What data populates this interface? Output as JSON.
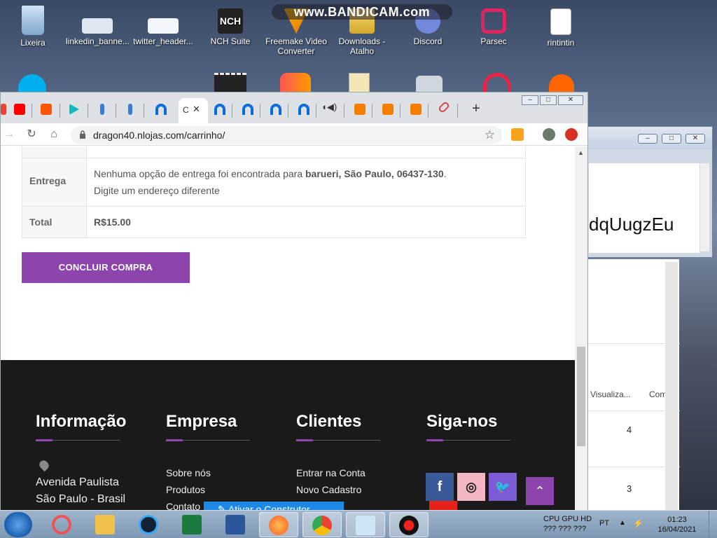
{
  "watermark": "www.BANDICAM.com",
  "desktop_icons": [
    {
      "label": "Lixeira"
    },
    {
      "label": "linkedin_banne..."
    },
    {
      "label": "twitter_header..."
    },
    {
      "label": "NCH Suite"
    },
    {
      "label": "Freemake Video Converter"
    },
    {
      "label": "Downloads - Atalho"
    },
    {
      "label": "Discord"
    },
    {
      "label": "Parsec"
    },
    {
      "label": "rintintin"
    }
  ],
  "browser": {
    "url": "dragon40.nlojas.com/carrinho/",
    "active_tab_label": "C"
  },
  "cart": {
    "rows": [
      {
        "label": "Entrega",
        "text_before": "Nenhuma opção de entrega foi encontrada para ",
        "text_bold": "barueri, São Paulo, 06437-130",
        "text_after": ".",
        "subtext": "Digite um endereço diferente"
      },
      {
        "label": "Total",
        "value": "R$15.00"
      }
    ],
    "checkout_button": "CONCLUIR COMPRA"
  },
  "footer": {
    "columns": [
      {
        "title": "Informação",
        "items": [
          "Avenida Paulista",
          "São Paulo - Brasil"
        ]
      },
      {
        "title": "Empresa",
        "items": [
          "Sobre nós",
          "Produtos",
          "Contato"
        ]
      },
      {
        "title": "Clientes",
        "items": [
          "Entrar na Conta",
          "Novo Cadastro"
        ]
      },
      {
        "title": "Siga-nos",
        "items": []
      }
    ],
    "builder_label": "Ativar o Construtor"
  },
  "background_window": {
    "text": "dqUugzEu",
    "col_headers": [
      "Visualiza...",
      "Com"
    ],
    "values": [
      "4",
      "3"
    ]
  },
  "taskbar": {
    "tray_line1": "CPU GPU HD",
    "tray_line2": "???  ???  ???",
    "language": "PT",
    "time": "01:23",
    "date": "16/04/2021"
  }
}
